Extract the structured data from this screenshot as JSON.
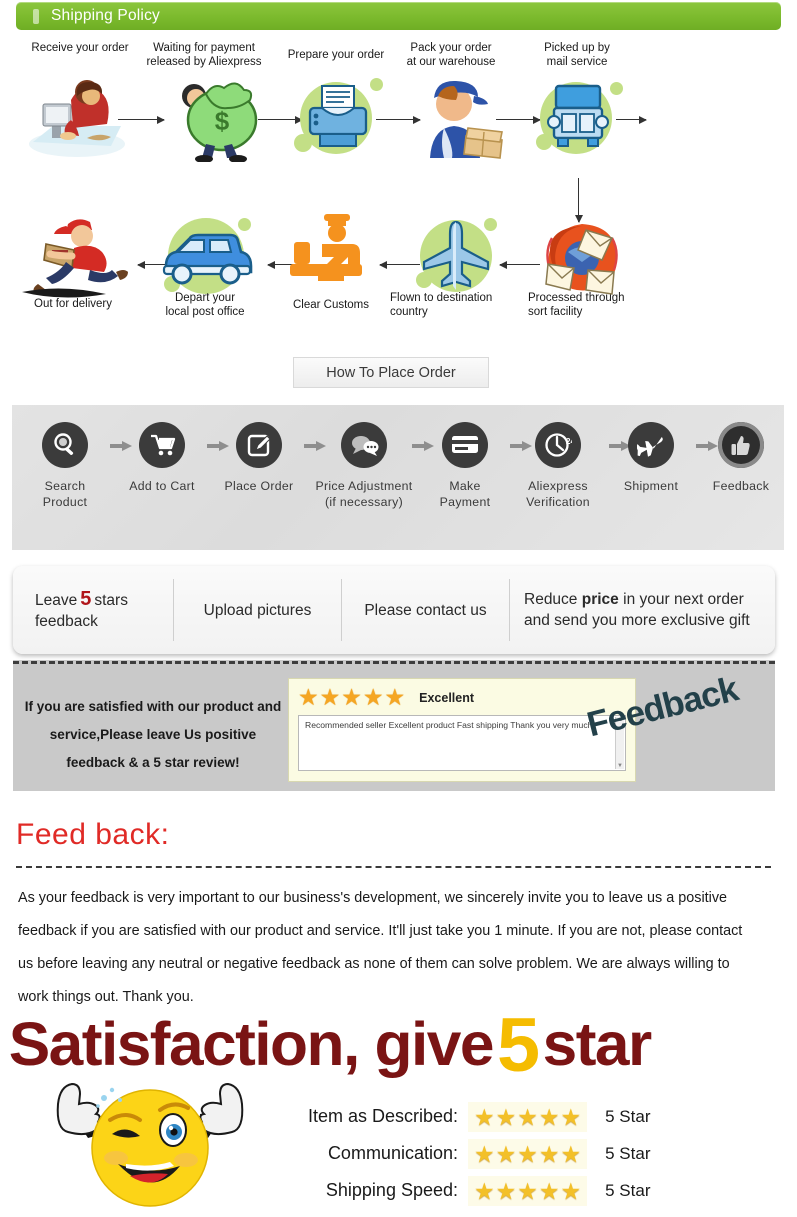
{
  "header": {
    "title": "Shipping Policy",
    "accent_color": "#7dbb2e"
  },
  "shipping_flow": {
    "row1": [
      {
        "label": "Receive your order",
        "icon": "person-at-computer-icon"
      },
      {
        "label": "Waiting for payment\nreleased by Aliexpress",
        "icon": "money-bag-icon"
      },
      {
        "label": "Prepare your order",
        "icon": "printer-icon"
      },
      {
        "label": "Pack your order\nat our warehouse",
        "icon": "worker-packing-icon"
      },
      {
        "label": "Picked up by\nmail service",
        "icon": "truck-icon"
      }
    ],
    "row2": [
      {
        "label": "Out for delivery",
        "icon": "running-courier-icon"
      },
      {
        "label": "Depart your\nlocal post office",
        "icon": "van-icon"
      },
      {
        "label": "Clear Customs",
        "icon": "customs-officer-icon"
      },
      {
        "label": "Flown to destination\ncountry",
        "icon": "airplane-icon"
      },
      {
        "label": "Processed through\nsort facility",
        "icon": "mail-sorting-icon"
      }
    ]
  },
  "how_to_place_order": {
    "button_label": "How To Place Order",
    "steps": [
      {
        "label": "Search\nProduct",
        "icon": "magnifier-icon"
      },
      {
        "label": "Add  to  Cart",
        "icon": "shopping-cart-icon"
      },
      {
        "label": "Place Order",
        "icon": "edit-note-icon"
      },
      {
        "label": "Price  Adjustment\n(if necessary)",
        "icon": "chat-bubbles-icon"
      },
      {
        "label": "Make\nPayment",
        "icon": "credit-card-icon"
      },
      {
        "label": "Aliexpress\nVerification",
        "icon": "clock-24-icon"
      },
      {
        "label": "Shipment",
        "icon": "airplane-icon"
      },
      {
        "label": "Feedback",
        "icon": "thumbs-up-icon"
      }
    ]
  },
  "request_strip": {
    "cell1_pre": "Leave",
    "cell1_num": "5",
    "cell1_post": "stars\nfeedback",
    "cell2": "Upload pictures",
    "cell3": "Please contact us",
    "cell4_line1_a": "Reduce",
    "cell4_line1_bold": "price",
    "cell4_line1_b": "in your next order",
    "cell4_line2": "and send you more exclusive gift"
  },
  "feedback_band": {
    "message": "If you are satisfied with our product and service,Please leave Us positive feedback & a 5 star review!",
    "review": {
      "stars": 5,
      "rating_word": "Excellent",
      "comment": "Recommended seller Excellent product Fast shipping Thank you very much."
    },
    "watermark": "Feedback"
  },
  "feedback_section": {
    "title": "Feed back:",
    "paragraph": "As your feedback is very important to our business's development, we sincerely invite you to leave us a positive feedback if you are satisfied with our product and service. It'll just take you 1 minute. If you are not, please contact us before leaving any neutral or negative feedback as none of them can solve problem. We are always willing to work things out. Thank you."
  },
  "headline": {
    "part1": "Satisfaction, give",
    "five": "5",
    "part2": "star",
    "color": "#7a1414",
    "five_color": "#f5bc00"
  },
  "ratings": [
    {
      "label": "Item as Described:",
      "stars": 5,
      "value": "5 Star"
    },
    {
      "label": "Communication:",
      "stars": 5,
      "value": "5 Star"
    },
    {
      "label": "Shipping Speed:",
      "stars": 5,
      "value": "5 Star"
    }
  ]
}
